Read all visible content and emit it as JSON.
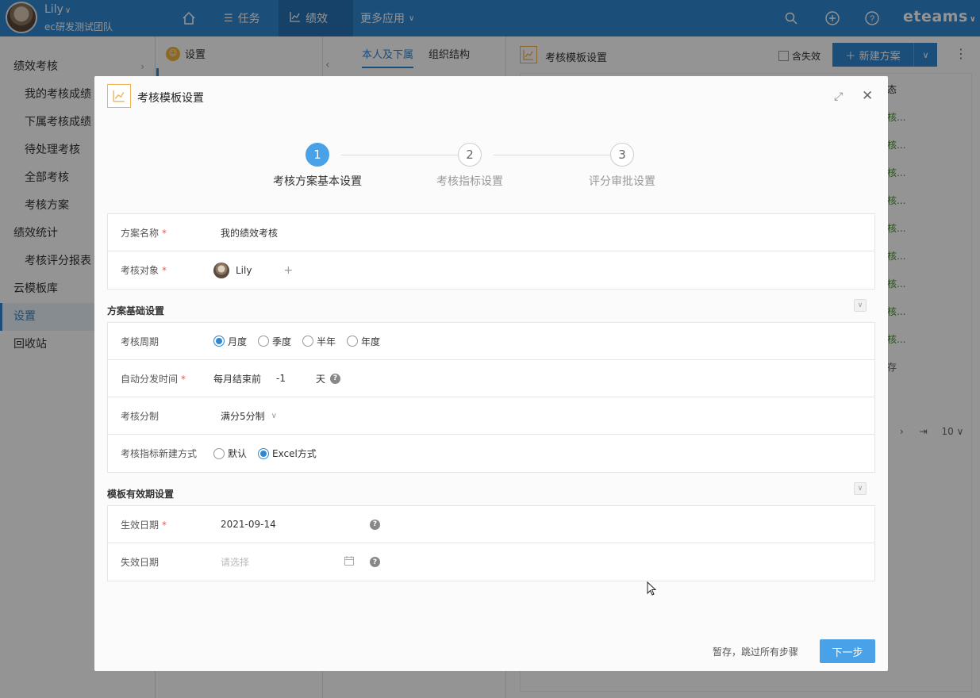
{
  "topbar": {
    "user_name": "Lily",
    "team_name": "ec研发测试团队",
    "nav": [
      {
        "label": "任务",
        "icon": "list-icon"
      },
      {
        "label": "绩效",
        "icon": "chart-icon"
      },
      {
        "label": "更多应用",
        "icon": "chevron-down-icon"
      }
    ],
    "brand": "eteams"
  },
  "sidebar": {
    "items": [
      {
        "label": "绩效考核"
      },
      {
        "label": "我的考核成绩"
      },
      {
        "label": "下属考核成绩"
      },
      {
        "label": "待处理考核"
      },
      {
        "label": "全部考核"
      },
      {
        "label": "考核方案"
      },
      {
        "label": "绩效统计"
      },
      {
        "label": "考核评分报表"
      },
      {
        "label": "云模板库"
      },
      {
        "label": "设置"
      },
      {
        "label": "回收站"
      }
    ]
  },
  "col2": {
    "title": "设置"
  },
  "col3": {
    "tabs": [
      {
        "label": "本人及下属"
      },
      {
        "label": "组织结构"
      }
    ]
  },
  "col4": {
    "title": "考核模板设置",
    "checkbox_label": "含失效",
    "new_button": "新建方案",
    "rows": [
      "态",
      "核...",
      "核...",
      "核...",
      "核...",
      "核...",
      "核...",
      "核...",
      "核...",
      "核...",
      "存"
    ],
    "page_size": "10"
  },
  "modal": {
    "title": "考核模板设置",
    "steps": [
      {
        "num": "1",
        "label": "考核方案基本设置"
      },
      {
        "num": "2",
        "label": "考核指标设置"
      },
      {
        "num": "3",
        "label": "评分审批设置"
      }
    ],
    "fields": {
      "plan_name_label": "方案名称",
      "plan_name_value": "我的绩效考核",
      "target_label": "考核对象",
      "target_value": "Lily"
    },
    "basic_section": {
      "title": "方案基础设置",
      "cycle_label": "考核周期",
      "cycle_options": [
        "月度",
        "季度",
        "半年",
        "年度"
      ],
      "auto_label": "自动分发时间",
      "auto_prefix": "每月结束前",
      "auto_value": "-1",
      "auto_unit": "天",
      "score_label": "考核分制",
      "score_value": "满分5分制",
      "method_label": "考核指标新建方式",
      "method_options": [
        "默认",
        "Excel方式"
      ]
    },
    "validity_section": {
      "title": "模板有效期设置",
      "start_label": "生效日期",
      "start_value": "2021-09-14",
      "end_label": "失效日期",
      "end_placeholder": "请选择"
    },
    "footer": {
      "save_link": "暂存，跳过所有步骤",
      "next_button": "下一步"
    }
  }
}
